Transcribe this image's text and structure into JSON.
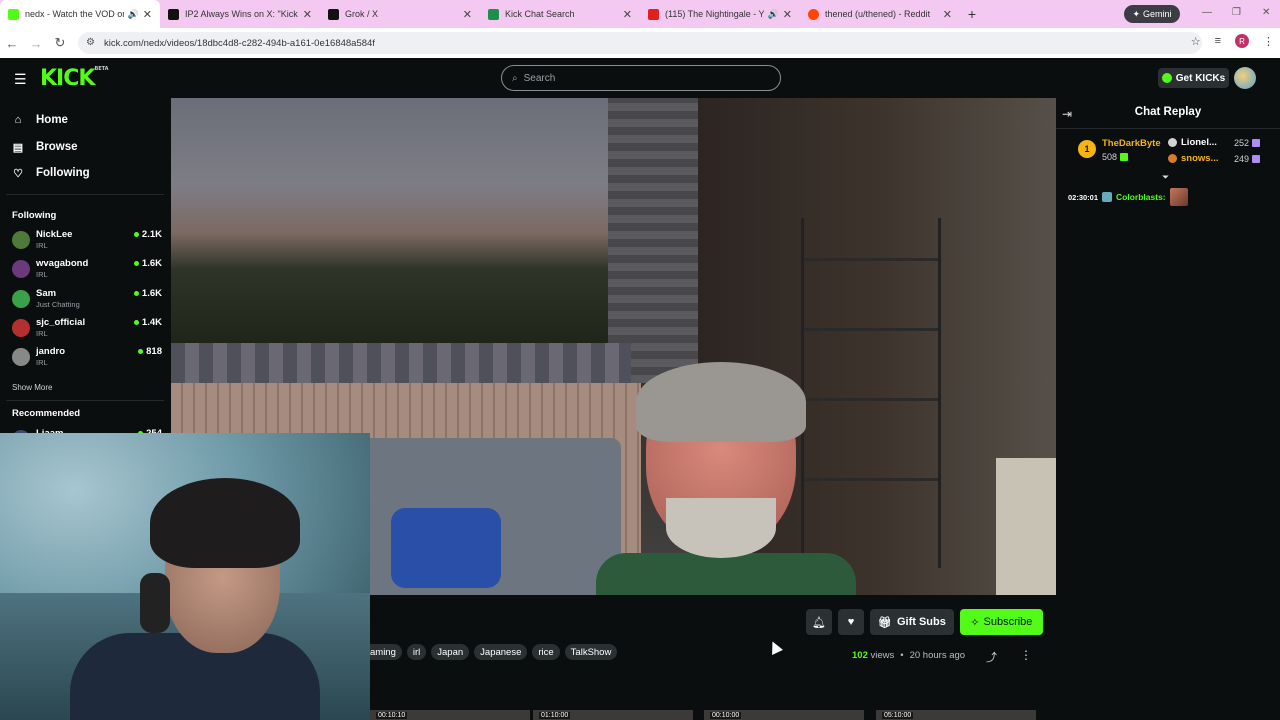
{
  "browser": {
    "tabs": [
      {
        "title": "nedx - Watch the VOD on K",
        "favicon_color": "#53fc18",
        "active": true,
        "audio": true
      },
      {
        "title": "IP2 Always Wins on X: \"Kick Str",
        "favicon_color": "#111111",
        "active": false,
        "audio": false
      },
      {
        "title": "Grok / X",
        "favicon_color": "#111111",
        "active": false,
        "audio": false
      },
      {
        "title": "Kick Chat Search",
        "favicon_color": "#1c8f4a",
        "active": false,
        "audio": false
      },
      {
        "title": "(115) The Nightingale - You",
        "favicon_color": "#e02020",
        "active": false,
        "audio": true
      },
      {
        "title": "thened (u/thened) - Reddit",
        "favicon_color": "#ff4500",
        "active": false,
        "audio": false
      }
    ],
    "gemini_label": "Gemini",
    "url": "kick.com/nedx/videos/18dbc4d8-c282-494b-a161-0e16848a584f",
    "profile_initial": "R"
  },
  "kick": {
    "logo": "KICK",
    "logo_tag": "BETA",
    "search_placeholder": "Search",
    "get_kicks_label": "Get KICKs",
    "brand_color": "#53fc18"
  },
  "sidebar": {
    "nav": [
      {
        "label": "Home",
        "icon": "home-icon"
      },
      {
        "label": "Browse",
        "icon": "browse-icon"
      },
      {
        "label": "Following",
        "icon": "heart-icon"
      }
    ],
    "following_header": "Following",
    "following": [
      {
        "name": "NickLee",
        "category": "IRL",
        "viewers": "2.1K",
        "color": "#4d7a3a"
      },
      {
        "name": "wvagabond",
        "category": "IRL",
        "viewers": "1.6K",
        "color": "#6a3a7a"
      },
      {
        "name": "Sam",
        "category": "Just Chatting",
        "viewers": "1.6K",
        "color": "#3aa04a"
      },
      {
        "name": "sjc_official",
        "category": "IRL",
        "viewers": "1.4K",
        "color": "#b43030"
      },
      {
        "name": "jandro",
        "category": "IRL",
        "viewers": "818",
        "color": "#888888"
      }
    ],
    "show_more": "Show More",
    "recommended_header": "Recommended",
    "recommended": [
      {
        "name": "Liaam",
        "viewers": "254"
      }
    ]
  },
  "video_actions": {
    "gift_subs_label": "Gift Subs",
    "subscribe_label": "Subscribe"
  },
  "tags": [
    "aming",
    "irl",
    "Japan",
    "Japanese",
    "rice",
    "TalkShow"
  ],
  "video_meta": {
    "views_count": "102",
    "views_label": "views",
    "separator": "•",
    "posted": "20 hours ago"
  },
  "thumbnails": [
    {
      "time": "00:10:10"
    },
    {
      "time": "01:10:00"
    },
    {
      "time": "00:10:00"
    },
    {
      "time": "05:10:00"
    }
  ],
  "chat": {
    "title": "Chat Replay",
    "top_gifter": {
      "rank": "1",
      "name": "TheDarkByte",
      "value": "508"
    },
    "ranked": [
      {
        "name": "Lionel...",
        "value": "252"
      },
      {
        "name": "snows...",
        "value": "249"
      }
    ],
    "messages": [
      {
        "time": "02:30:01",
        "user": "Colorblasts:"
      }
    ]
  }
}
